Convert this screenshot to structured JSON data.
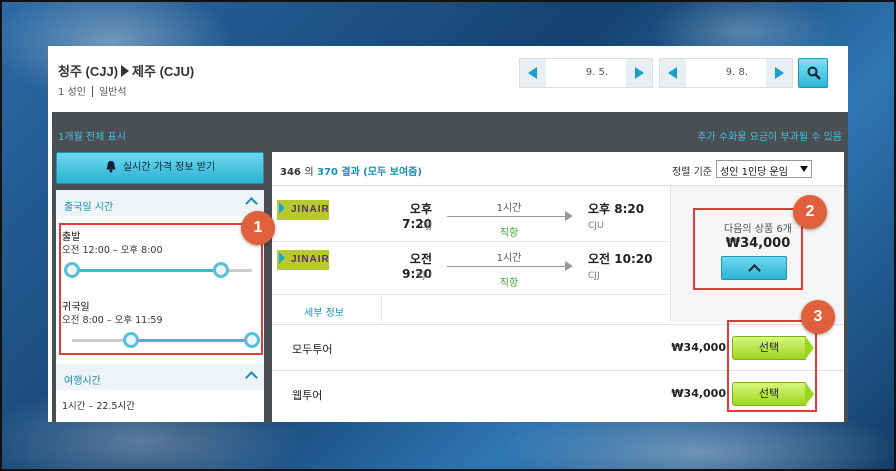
{
  "header": {
    "origin": "청주 (CJJ)",
    "destination": "제주 (CJU)",
    "passengers": "1 성인",
    "cabin": "일반석",
    "depart_date": "9. 5.",
    "return_date": "9. 8."
  },
  "panel": {
    "show_month": "1개월 전체 표시",
    "extra_fee_notice": "추가 수화물 요금이 부과될 수 있음",
    "price_alert_button": "실시간 가격 정보 받기"
  },
  "filters": {
    "departure_time_title": "출국일 시간",
    "outbound": {
      "label": "출발",
      "range": "오전 12:00 – 오후 8:00",
      "min": 0,
      "max": 0.83
    },
    "inbound": {
      "label": "귀국일",
      "range": "오전 8:00 – 오후 11:59",
      "min": 0.33,
      "max": 1.0
    },
    "travel_time_title": "여행시간",
    "travel_time_range": "1시간 – 22.5시간"
  },
  "results": {
    "shown": "346",
    "of": "의",
    "total": "370",
    "total_suffix": "결과 (모두 보여줌)",
    "sort_label": "정렬 기준",
    "sort_value": "성인 1인당 운임"
  },
  "itinerary": {
    "legs": [
      {
        "airline": "JINAIR",
        "dep_time": "오후 7:20",
        "dep_code": "CJJ",
        "duration": "1시간",
        "stops": "직항",
        "arr_time": "오후 8:20",
        "arr_code": "CJU"
      },
      {
        "airline": "JINAIR",
        "dep_time": "오전 9:20",
        "dep_code": "CJU",
        "duration": "1시간",
        "stops": "직항",
        "arr_time": "오전 10:20",
        "arr_code": "CJJ"
      }
    ],
    "detail_link": "세부 정보",
    "next_deals": "다음의 상품 6개",
    "price": "₩34,000"
  },
  "agents": [
    {
      "name": "모두투어",
      "price": "₩34,000",
      "select": "선택"
    },
    {
      "name": "웹투어",
      "price": "₩34,000",
      "select": "선택"
    }
  ],
  "annotations": [
    "1",
    "2",
    "3"
  ]
}
